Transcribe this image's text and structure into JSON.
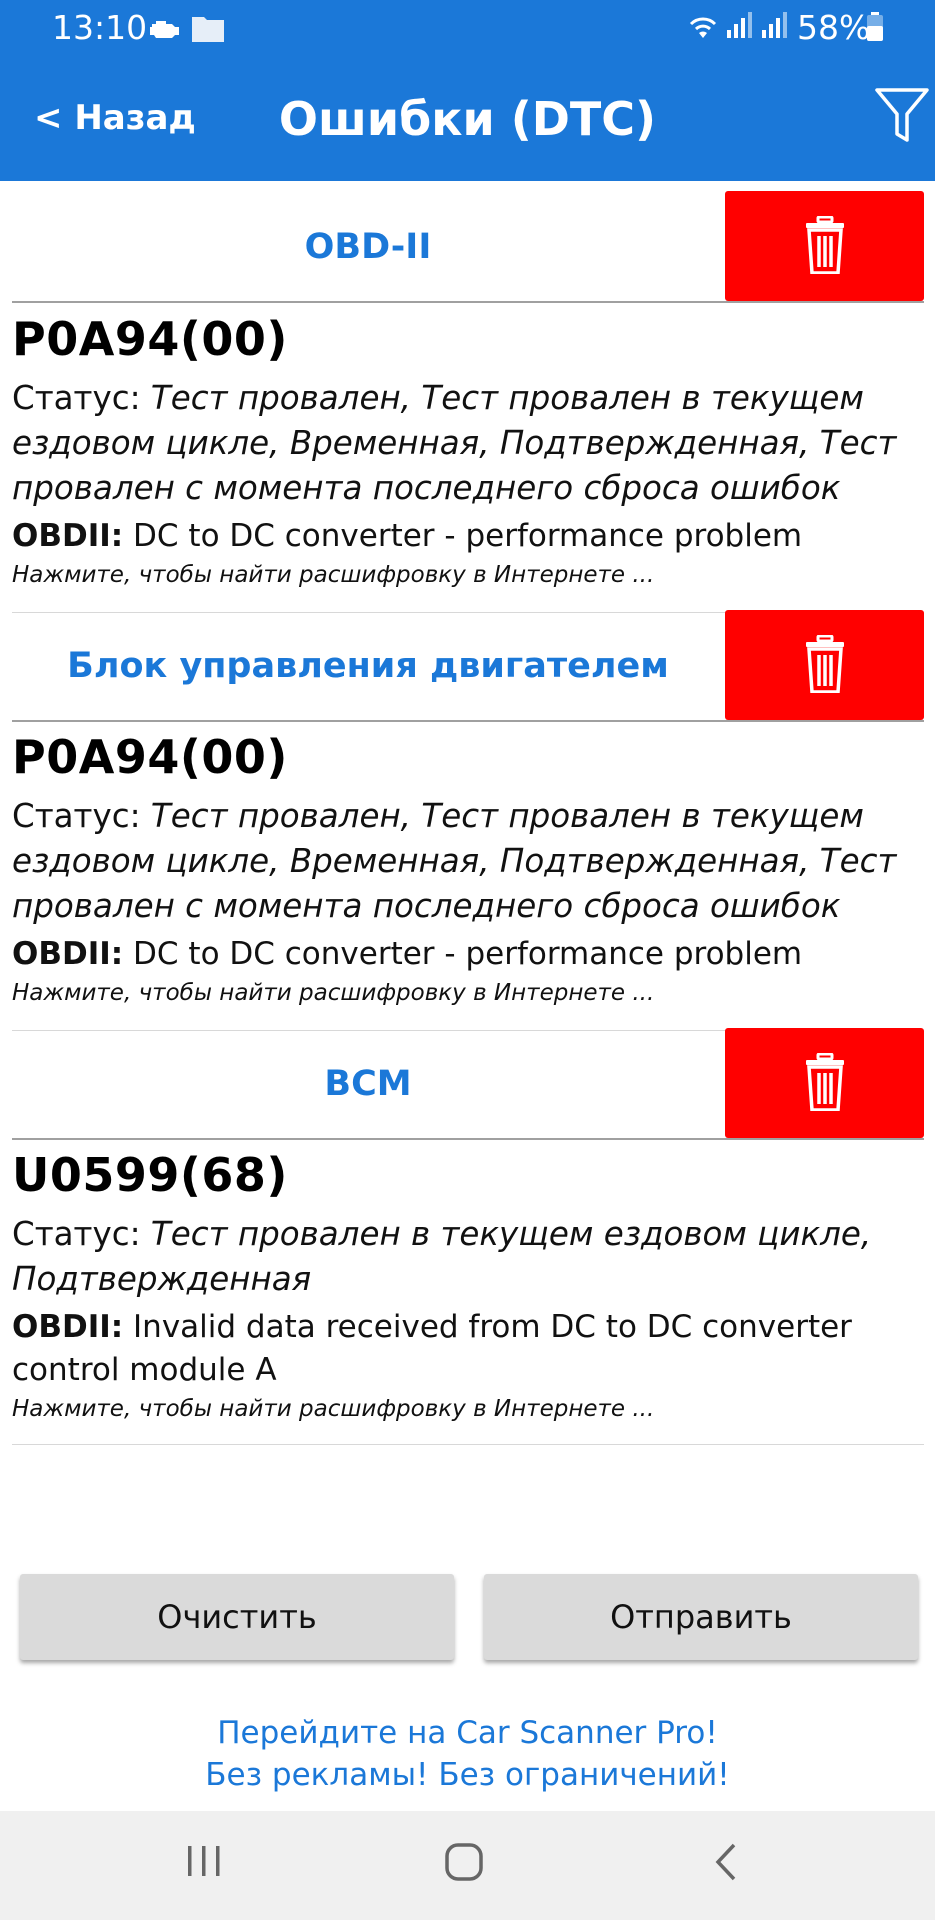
{
  "status_bar": {
    "time": "13:10",
    "battery": "58%"
  },
  "header": {
    "back_label": "< Назад",
    "title": "Ошибки (DTC)"
  },
  "groups": [
    {
      "title": "OBD-II",
      "dtc": {
        "code": "P0A94(00)",
        "status_label": "Статус: ",
        "status_value": "Тест провален, Тест провален в текущем ездовом цикле, Временная, Подтвержденная, Тест провален с момента последнего сброса ошибок",
        "desc_label": "OBDII:",
        "desc_value": " DC to DC converter - performance problem",
        "hint": "Нажмите, чтобы найти расшифровку в Интернете ..."
      }
    },
    {
      "title": "Блок управления двигателем",
      "dtc": {
        "code": "P0A94(00)",
        "status_label": "Статус: ",
        "status_value": "Тест провален, Тест провален в текущем ездовом цикле, Временная, Подтвержденная, Тест провален с момента последнего сброса ошибок",
        "desc_label": "OBDII:",
        "desc_value": " DC to DC converter - performance problem",
        "hint": "Нажмите, чтобы найти расшифровку в Интернете ..."
      }
    },
    {
      "title": "BCM",
      "dtc": {
        "code": "U0599(68)",
        "status_label": "Статус: ",
        "status_value": "Тест провален в текущем ездовом цикле, Подтвержденная",
        "desc_label": "OBDII:",
        "desc_value": " Invalid data received from DC to DC converter control module A",
        "hint": "Нажмите, чтобы найти расшифровку в Интернете ..."
      }
    }
  ],
  "actions": {
    "clear_label": "Очистить",
    "send_label": "Отправить"
  },
  "promo": {
    "line1": "Перейдите на Car Scanner Pro!",
    "line2": "Без рекламы! Без ограничений!"
  },
  "colors": {
    "primary": "#1b78d8",
    "delete": "#ff0000",
    "button_bg": "#dadada"
  }
}
